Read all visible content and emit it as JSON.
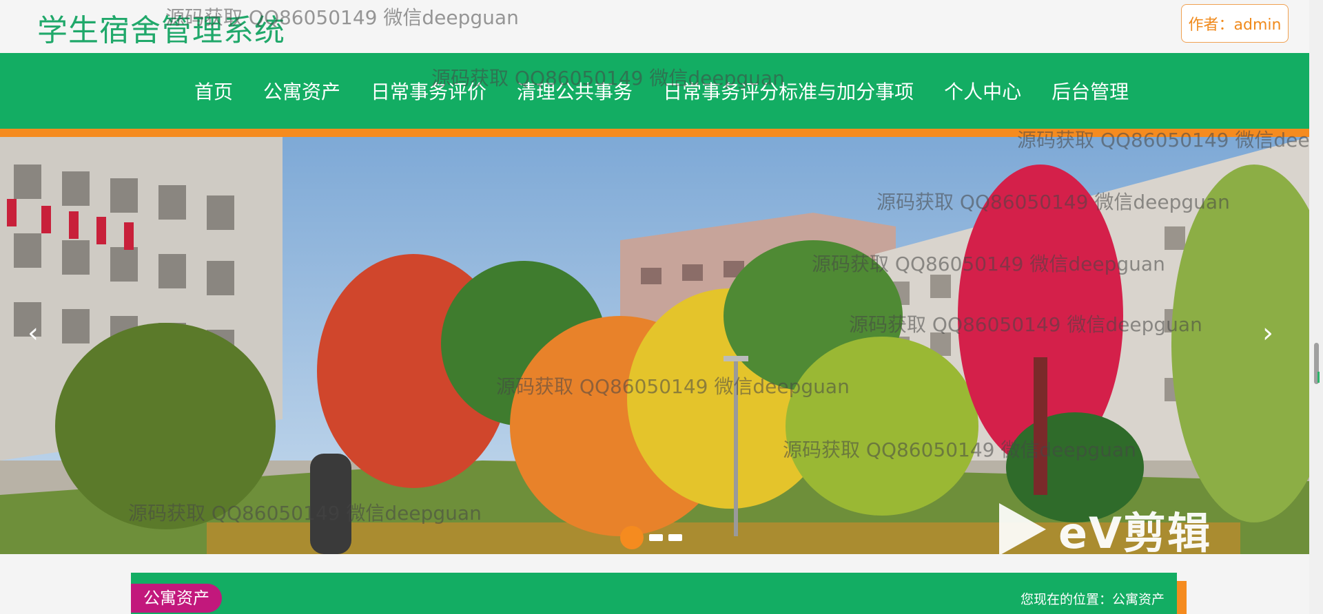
{
  "header": {
    "title": "学生宿舍管理系统",
    "author_button": "作者：admin"
  },
  "nav": {
    "items": [
      "首页",
      "公寓资产",
      "日常事务评价",
      "清理公共事务",
      "日常事务评分标准与加分事项",
      "个人中心",
      "后台管理"
    ]
  },
  "banner": {
    "prev_arrow": "‹",
    "next_arrow": "›",
    "slide_count": 3,
    "active_slide": 1,
    "logo_text": "eV剪辑"
  },
  "section": {
    "tag": "公寓资产",
    "location": "您现在的位置：公寓资产"
  },
  "watermark_text": "源码获取 QQ86050149 微信deepguan",
  "watermark_partial": "源码获取 QQ86050149 微信dee",
  "colors": {
    "primary_green": "#13ad63",
    "title_green": "#20a86a",
    "accent_orange": "#f58b1f",
    "tag_magenta": "#c2187c"
  }
}
